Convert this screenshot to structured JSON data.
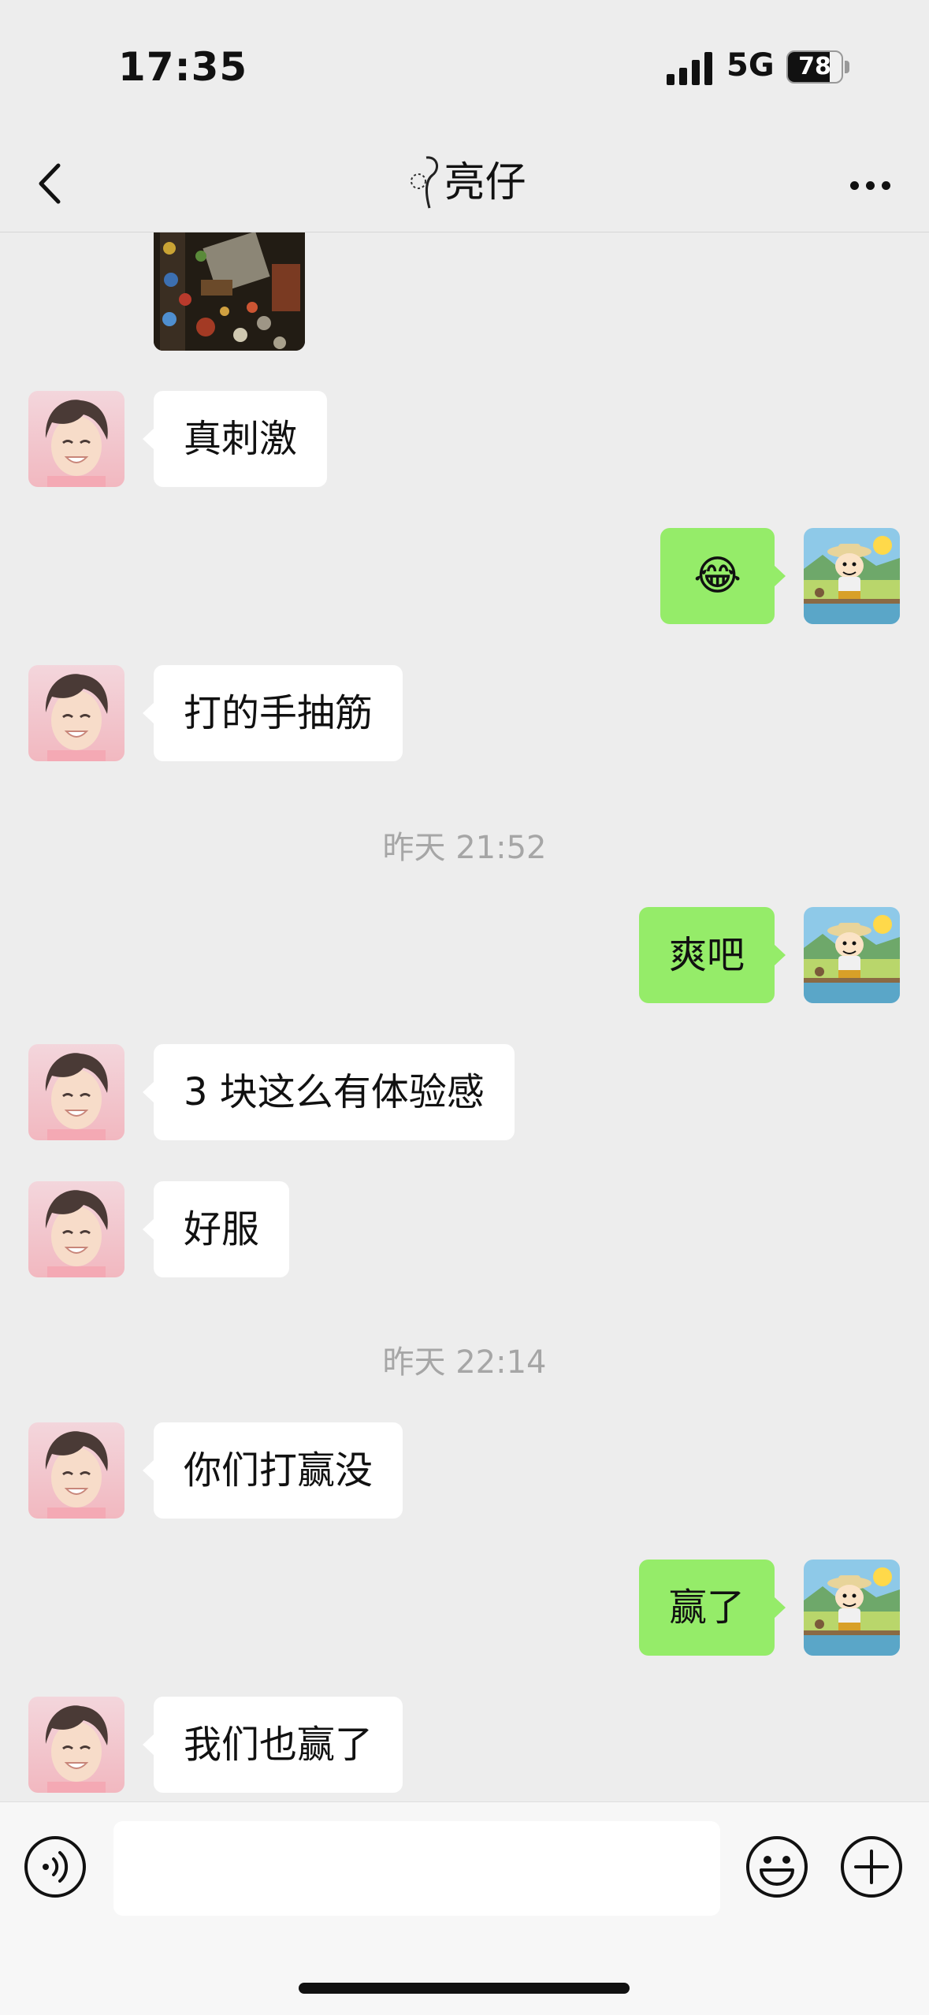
{
  "status_bar": {
    "time": "17:35",
    "network": "5G",
    "battery": "78",
    "battery_level": 0.78
  },
  "nav": {
    "title": "亮仔"
  },
  "messages": [
    {
      "side": "left",
      "text": "真刺激"
    },
    {
      "side": "right",
      "text": "😂"
    },
    {
      "side": "left",
      "text": "打的手抽筋"
    },
    {
      "timestamp": "昨天 21:52"
    },
    {
      "side": "right",
      "text": "爽吧"
    },
    {
      "side": "left",
      "text": "3 块这么有体验感"
    },
    {
      "side": "left",
      "text": "好服"
    },
    {
      "timestamp": "昨天 22:14"
    },
    {
      "side": "left",
      "text": "你们打赢没"
    },
    {
      "side": "right",
      "text": "赢了"
    },
    {
      "side": "left",
      "text": "我们也赢了"
    }
  ],
  "input": {
    "value": ""
  },
  "colors": {
    "self_bubble": "#95ec69",
    "other_bubble": "#ffffff",
    "background": "#ededed"
  },
  "icons": [
    "chevron-left-icon",
    "more-dots-icon",
    "voice-icon",
    "emoji-icon",
    "plus-icon",
    "signal-icon",
    "battery-icon"
  ]
}
